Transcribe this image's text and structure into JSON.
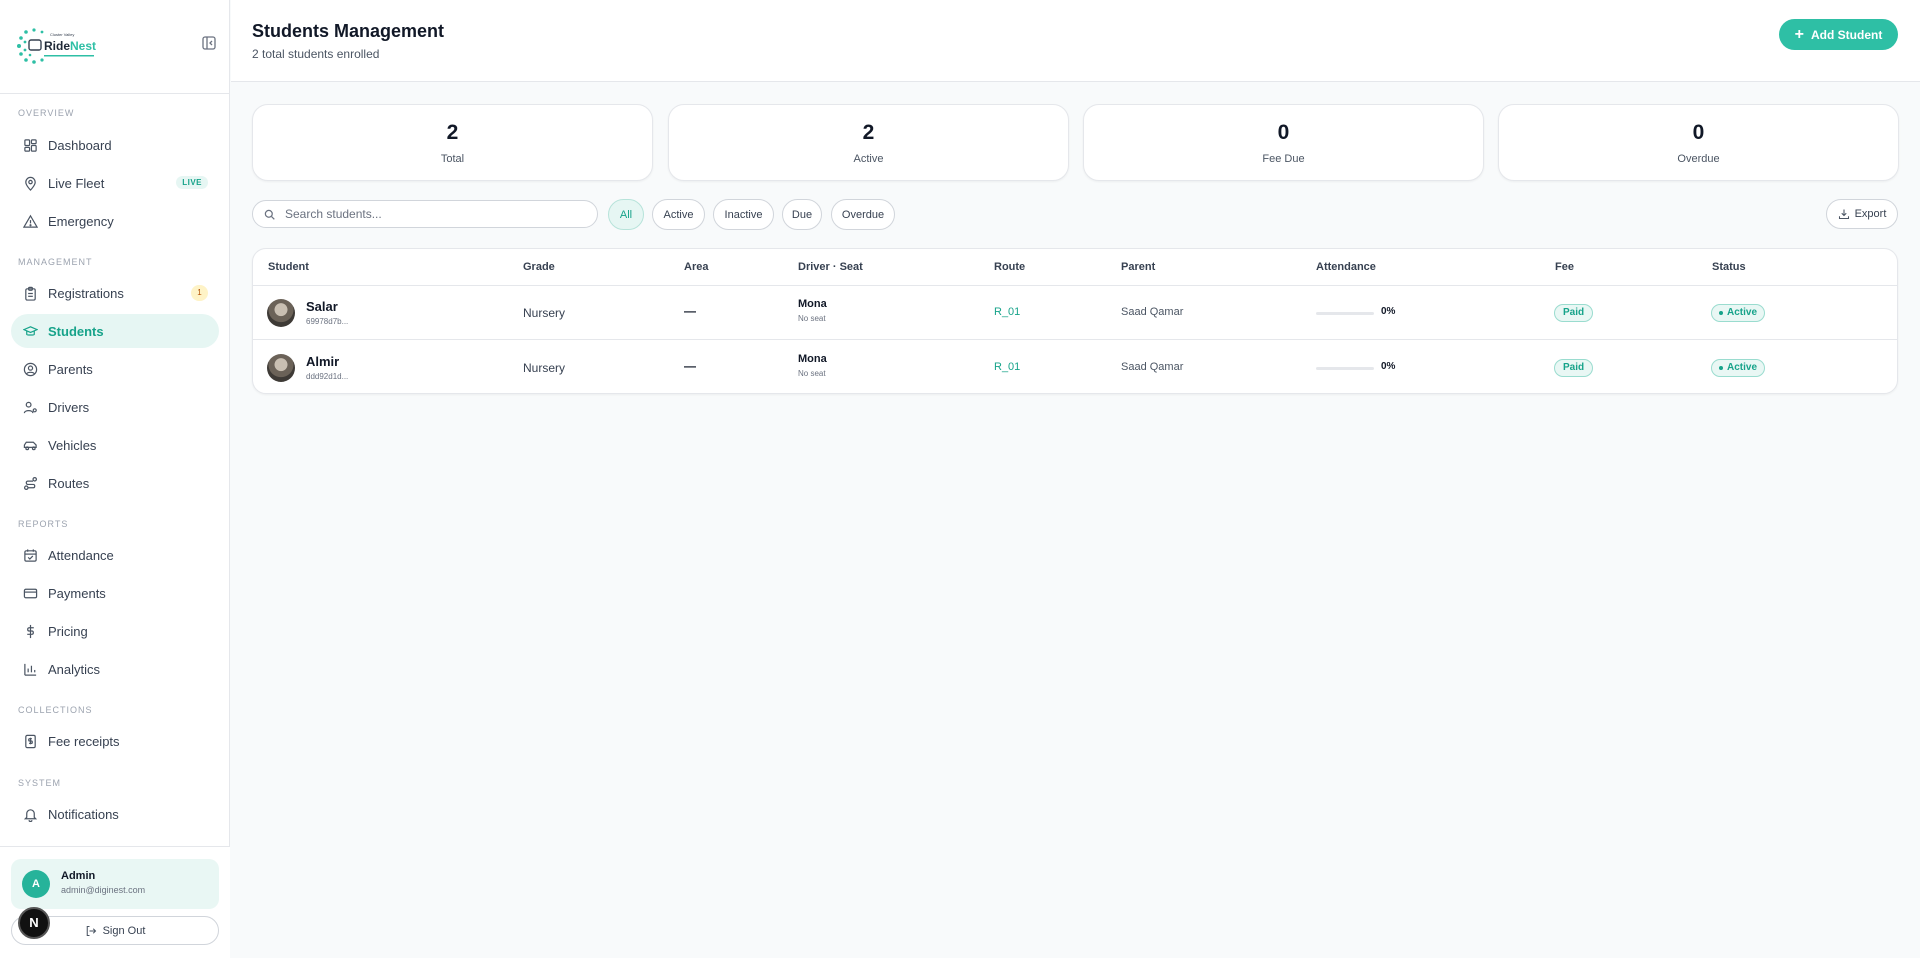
{
  "sidebar": {
    "logo_text": "RideNest",
    "logo_top_text": "Cluster Valley",
    "sections": {
      "overview": "OVERVIEW",
      "management": "MANAGEMENT",
      "reports": "REPORTS",
      "collections": "COLLECTIONS",
      "system": "SYSTEM"
    },
    "items": {
      "dashboard": "Dashboard",
      "live_fleet": "Live Fleet",
      "live_badge": "LIVE",
      "emergency": "Emergency",
      "registrations": "Registrations",
      "registrations_count": "1",
      "students": "Students",
      "parents": "Parents",
      "drivers": "Drivers",
      "vehicles": "Vehicles",
      "routes": "Routes",
      "attendance": "Attendance",
      "payments": "Payments",
      "pricing": "Pricing",
      "analytics": "Analytics",
      "fee_receipts": "Fee receipts",
      "notifications": "Notifications"
    },
    "user": {
      "initial": "A",
      "name": "Admin",
      "email": "admin@diginest.com",
      "sign_out": "Sign Out"
    },
    "dev_badge": "N"
  },
  "header": {
    "title": "Students Management",
    "subtitle": "2 total students enrolled",
    "add_button": "Add Student"
  },
  "stats": [
    {
      "value": "2",
      "label": "Total"
    },
    {
      "value": "2",
      "label": "Active"
    },
    {
      "value": "0",
      "label": "Fee Due"
    },
    {
      "value": "0",
      "label": "Overdue"
    }
  ],
  "search": {
    "placeholder": "Search students..."
  },
  "filters": [
    "All",
    "Active",
    "Inactive",
    "Due",
    "Overdue"
  ],
  "export_label": "Export",
  "table": {
    "columns": [
      "Student",
      "Grade",
      "Area",
      "Driver · Seat",
      "Route",
      "Parent",
      "Attendance",
      "Fee",
      "Status"
    ],
    "rows": [
      {
        "name": "Salar",
        "id": "69978d7b...",
        "grade": "Nursery",
        "area": "—",
        "driver": "Mona",
        "seat": "No seat",
        "route": "R_01",
        "parent": "Saad Qamar",
        "attendance": "0%",
        "attendance_value": 0,
        "fee": "Paid",
        "status": "Active"
      },
      {
        "name": "Almir",
        "id": "ddd92d1d...",
        "grade": "Nursery",
        "area": "—",
        "driver": "Mona",
        "seat": "No seat",
        "route": "R_01",
        "parent": "Saad Qamar",
        "attendance": "0%",
        "attendance_value": 0,
        "fee": "Paid",
        "status": "Active"
      }
    ]
  },
  "colors": {
    "accent": "#2ebfa5",
    "accent_dark": "#17a38a",
    "accent_bg": "#e6f6f3"
  }
}
